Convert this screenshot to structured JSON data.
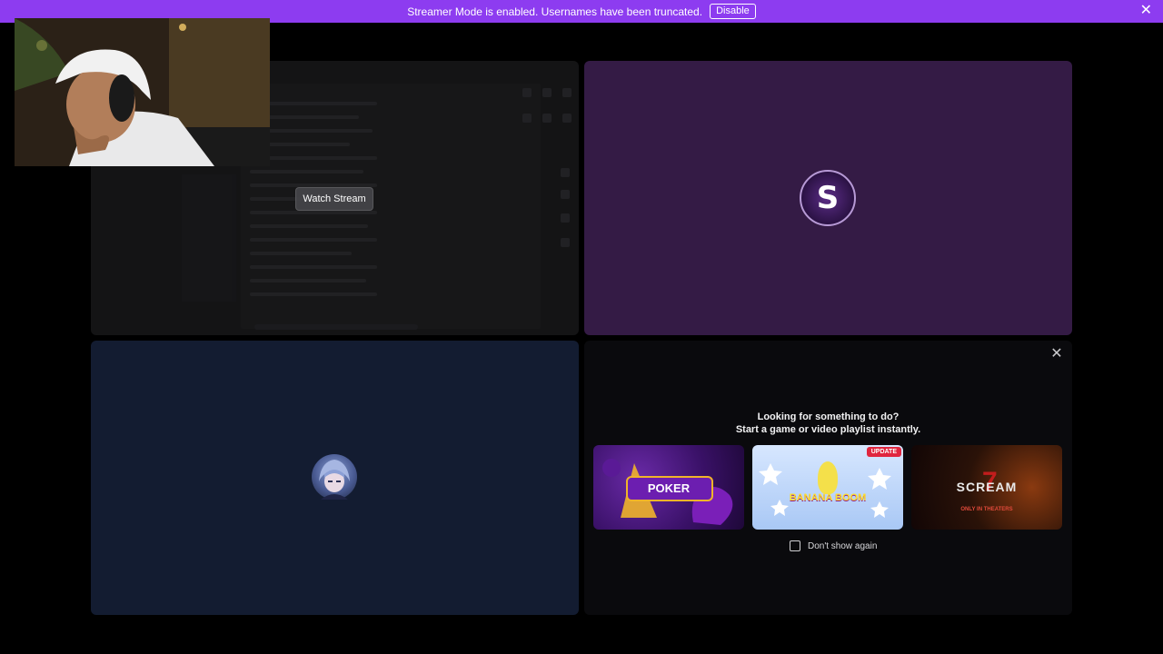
{
  "banner": {
    "message": "Streamer Mode is enabled. Usernames have been truncated.",
    "disable_label": "Disable",
    "close_icon": "close-icon",
    "color": "#8d3cf0"
  },
  "screen_tile": {
    "watch_label": "Watch Stream"
  },
  "webcam": {
    "icon": "webcam-feed"
  },
  "purple_tile": {
    "avatar_letter": "S",
    "color": "#341b45"
  },
  "navy_tile": {
    "color": "#131c31"
  },
  "activity": {
    "title_line1": "Looking for something to do?",
    "title_line2": "Start a game or video playlist instantly.",
    "cards": [
      {
        "name": "poker",
        "label": "POKER"
      },
      {
        "name": "banana",
        "label": "BANANA BOOM",
        "badge": "UPDATE"
      },
      {
        "name": "scream",
        "label": "SCREAM",
        "sub": "ONLY IN THEATERS"
      }
    ],
    "dont_show_label": "Don't show again",
    "close_icon": "close-icon"
  }
}
